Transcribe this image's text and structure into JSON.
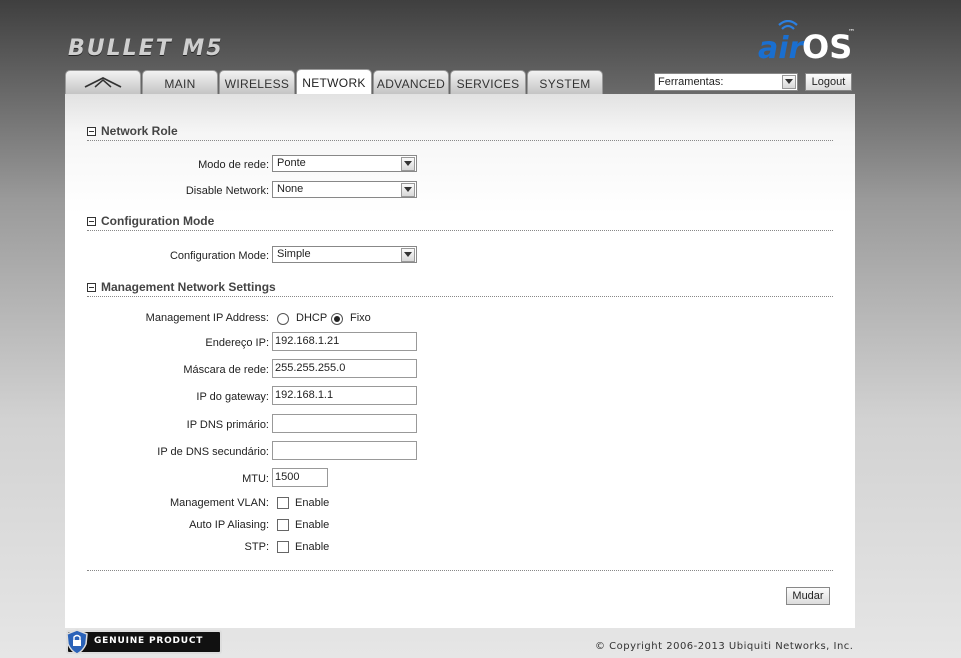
{
  "header": {
    "product": "BULLET M5",
    "brand": "airOS",
    "tm": "™"
  },
  "tabs": [
    {
      "label": "",
      "icon": "ubnt-logo-icon"
    },
    {
      "label": "MAIN"
    },
    {
      "label": "WIRELESS"
    },
    {
      "label": "NETWORK",
      "active": true
    },
    {
      "label": "ADVANCED"
    },
    {
      "label": "SERVICES"
    },
    {
      "label": "SYSTEM"
    }
  ],
  "toolbar": {
    "tools_value": "Ferramentas:",
    "logout_label": "Logout"
  },
  "network_role": {
    "title": "Network Role",
    "mode_label": "Modo de rede:",
    "mode_value": "Ponte",
    "disable_label": "Disable Network:",
    "disable_value": "None"
  },
  "configuration_mode": {
    "title": "Configuration Mode",
    "label": "Configuration Mode:",
    "value": "Simple"
  },
  "management": {
    "title": "Management Network Settings",
    "ip_address_label": "Management IP Address:",
    "dhcp_label": "DHCP",
    "fixed_label": "Fixo",
    "selected": "Fixo",
    "ip_label": "Endereço IP:",
    "ip_value": "192.168.1.21",
    "mask_label": "Máscara de rede:",
    "mask_value": "255.255.255.0",
    "gateway_label": "IP do gateway:",
    "gateway_value": "192.168.1.1",
    "dns1_label": "IP DNS primário:",
    "dns1_value": "",
    "dns2_label": "IP de DNS secundário:",
    "dns2_value": "",
    "mtu_label": "MTU:",
    "mtu_value": "1500",
    "vlan_label": "Management VLAN:",
    "alias_label": "Auto IP Aliasing:",
    "stp_label": "STP:",
    "enable_label": "Enable"
  },
  "actions": {
    "change_label": "Mudar"
  },
  "footer": {
    "badge_text": "GENUINE  PRODUCT",
    "copyright": "© Copyright 2006-2013 Ubiquiti Networks, Inc."
  },
  "colors": {
    "brand_blue": "#1a6fd0",
    "panel_bg": "#ffffff"
  }
}
